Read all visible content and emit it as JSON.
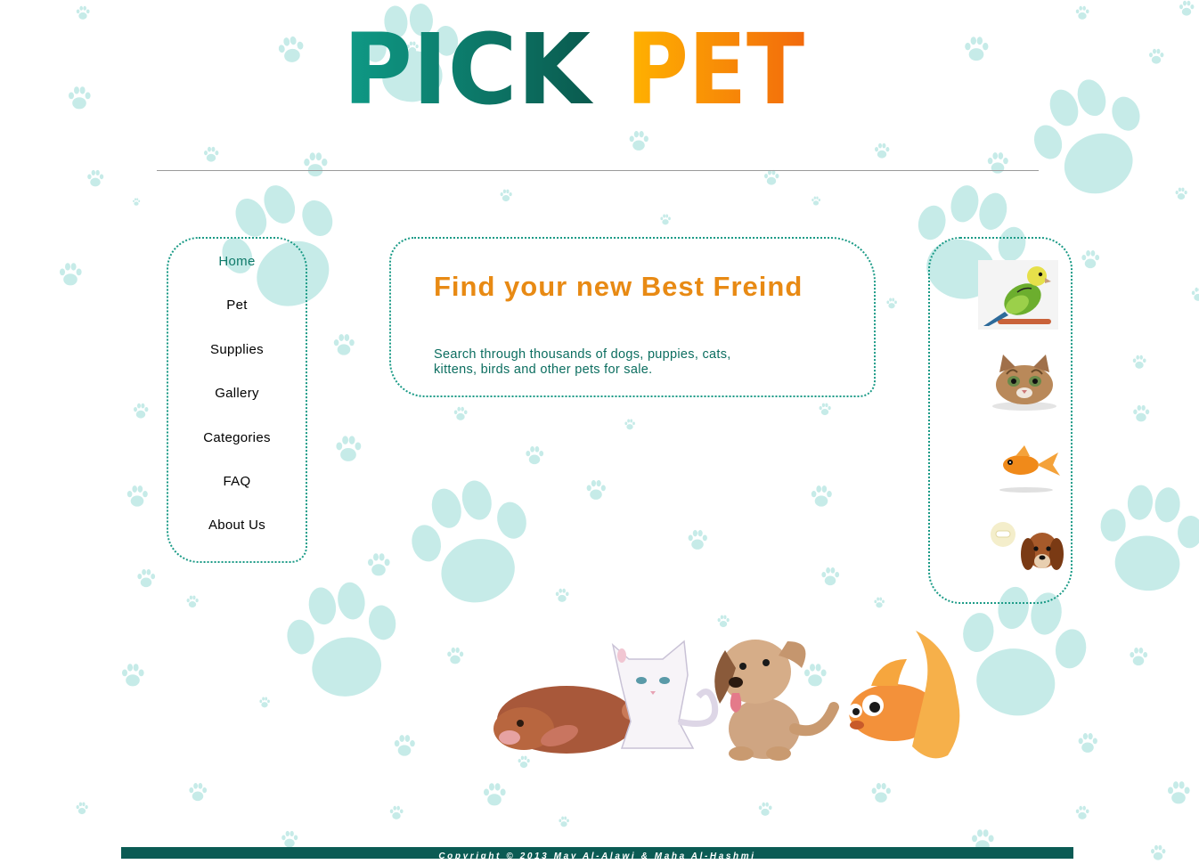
{
  "logo": {
    "word1": "PICK",
    "word2": "PET"
  },
  "nav": {
    "items": [
      {
        "label": "Home",
        "active": true
      },
      {
        "label": "Pet"
      },
      {
        "label": "Supplies"
      },
      {
        "label": "Gallery"
      },
      {
        "label": "Categories"
      },
      {
        "label": "FAQ"
      },
      {
        "label": "About Us"
      }
    ]
  },
  "content": {
    "title": "Find your new Best Freind",
    "text": "Search through thousands of dogs, puppies, cats, kittens, birds and other pets for sale."
  },
  "side_pets": [
    "budgie-photo",
    "kitten-photo",
    "goldfish-photo",
    "puppy-photo"
  ],
  "banner": [
    "rabbit",
    "cat",
    "dog",
    "goldfish"
  ],
  "footer": {
    "copyright": "Copyright © 2013 May Al-Alawi & Maha Al-Hashmi"
  },
  "colors": {
    "teal": "#1a9a86",
    "dark_teal": "#0b5b54",
    "orange": "#e88a14",
    "paw": "#c6ebe8"
  }
}
